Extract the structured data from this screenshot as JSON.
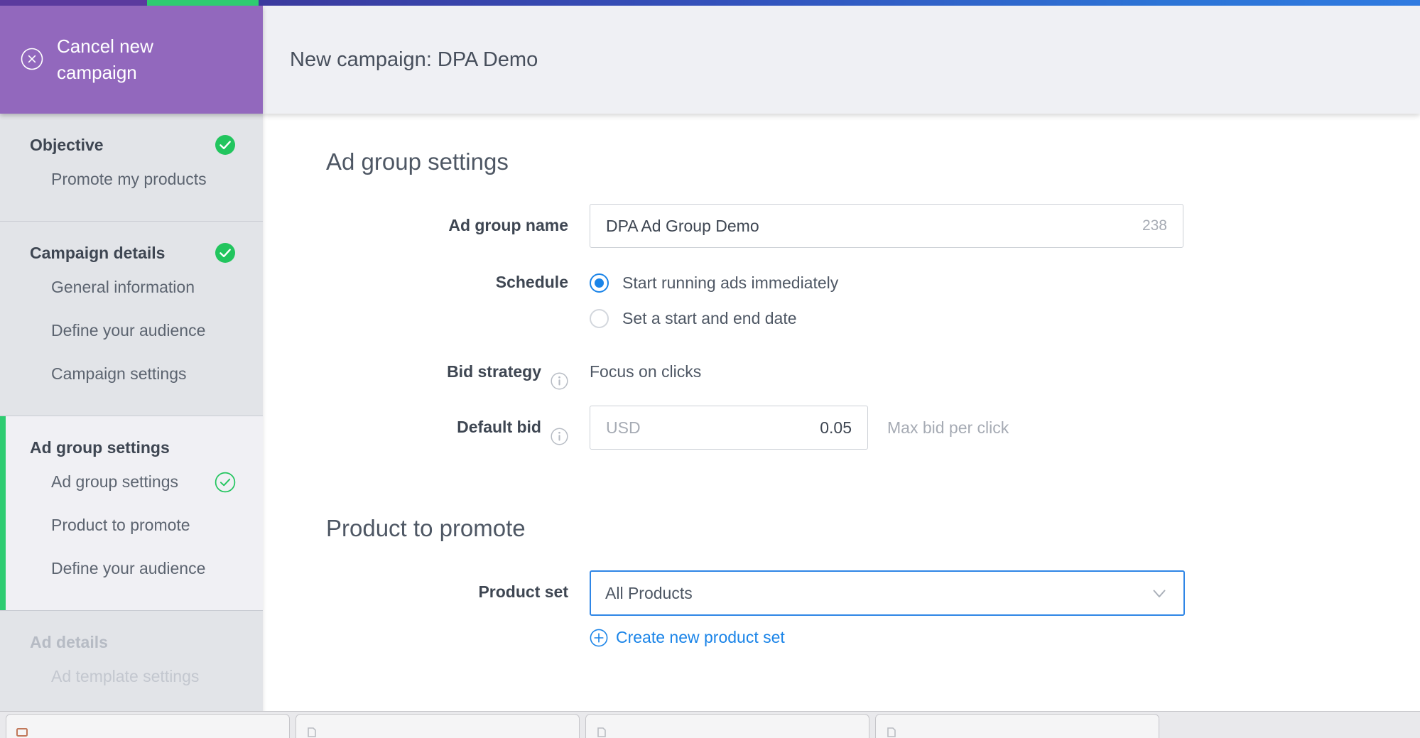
{
  "progress": {
    "segments": [
      {
        "name": "objective",
        "color": "#5b3a9e"
      },
      {
        "name": "campaign-details",
        "color": "#2ecc71"
      },
      {
        "name": "remaining",
        "color": "#2f7ae0"
      }
    ]
  },
  "cancel": {
    "label": "Cancel new campaign",
    "icon": "close-circle-icon"
  },
  "header": {
    "title": "New campaign: DPA Demo"
  },
  "sidebar": {
    "sections": [
      {
        "title": "Objective",
        "state": "complete",
        "badge": "check-filled",
        "items": [
          {
            "label": "Promote my products",
            "badge": null
          }
        ]
      },
      {
        "title": "Campaign details",
        "state": "complete",
        "badge": "check-filled",
        "items": [
          {
            "label": "General information",
            "badge": null
          },
          {
            "label": "Define your audience",
            "badge": null
          },
          {
            "label": "Campaign settings",
            "badge": null
          }
        ]
      },
      {
        "title": "Ad group settings",
        "state": "active",
        "badge": null,
        "items": [
          {
            "label": "Ad group settings",
            "badge": "check-outline"
          },
          {
            "label": "Product to promote",
            "badge": null
          },
          {
            "label": "Define your audience",
            "badge": null
          }
        ]
      },
      {
        "title": "Ad details",
        "state": "disabled",
        "badge": null,
        "items": [
          {
            "label": "Ad template settings",
            "badge": null
          }
        ]
      }
    ]
  },
  "main": {
    "section_one": {
      "heading": "Ad group settings",
      "ad_group_name": {
        "label": "Ad group name",
        "value": "DPA Ad Group Demo",
        "placeholder": "Ad group name",
        "counter": "238"
      },
      "schedule": {
        "label": "Schedule",
        "options": [
          {
            "label": "Start running ads immediately",
            "selected": true
          },
          {
            "label": "Set a start and end date",
            "selected": false
          }
        ]
      },
      "bid_strategy": {
        "label": "Bid strategy",
        "value": "Focus on clicks",
        "info_icon": "info-icon"
      },
      "default_bid": {
        "label": "Default bid",
        "currency": "USD",
        "amount": "0.05",
        "hint": "Max bid per click",
        "info_icon": "info-icon"
      }
    },
    "section_two": {
      "heading": "Product to promote",
      "product_set": {
        "label": "Product set",
        "value": "All Products",
        "chevron_icon": "chevron-down-icon"
      },
      "create_link": {
        "label": "Create new product set",
        "icon": "plus-circle-icon"
      }
    }
  },
  "colors": {
    "brand_purple": "#9268bd",
    "accent_green": "#2ecc71",
    "accent_blue": "#1a84e8",
    "progress_indigo": "#5b3a9e"
  },
  "browser_tabs": [
    {
      "name": "tab-1"
    },
    {
      "name": "tab-2"
    },
    {
      "name": "tab-3"
    },
    {
      "name": "tab-4"
    }
  ]
}
